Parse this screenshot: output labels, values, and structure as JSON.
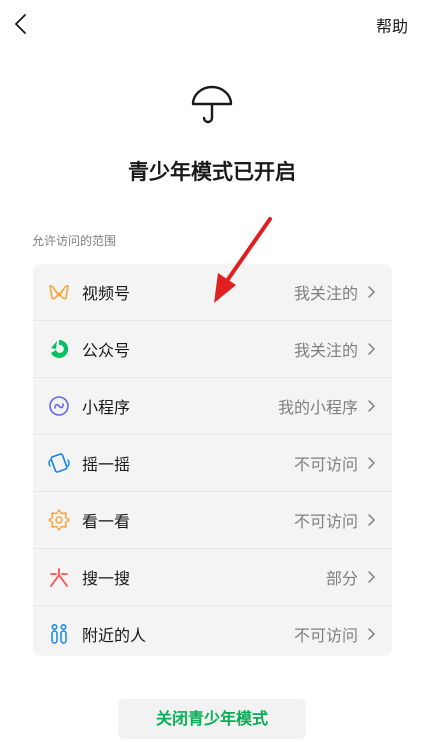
{
  "header": {
    "help_label": "帮助"
  },
  "main": {
    "title": "青少年模式已开启",
    "section_label": "允许访问的范围",
    "items": [
      {
        "label": "视频号",
        "value": "我关注的",
        "icon": "channels-icon"
      },
      {
        "label": "公众号",
        "value": "我关注的",
        "icon": "official-accounts-icon"
      },
      {
        "label": "小程序",
        "value": "我的小程序",
        "icon": "mini-program-icon"
      },
      {
        "label": "摇一摇",
        "value": "不可访问",
        "icon": "shake-icon"
      },
      {
        "label": "看一看",
        "value": "不可访问",
        "icon": "top-stories-icon"
      },
      {
        "label": "搜一搜",
        "value": "部分",
        "icon": "search-icon"
      },
      {
        "label": "附近的人",
        "value": "不可访问",
        "icon": "people-nearby-icon"
      }
    ]
  },
  "footer": {
    "close_button_label": "关闭青少年模式"
  },
  "colors": {
    "accent_green": "#06ae56",
    "arrow_red": "#e02020"
  }
}
